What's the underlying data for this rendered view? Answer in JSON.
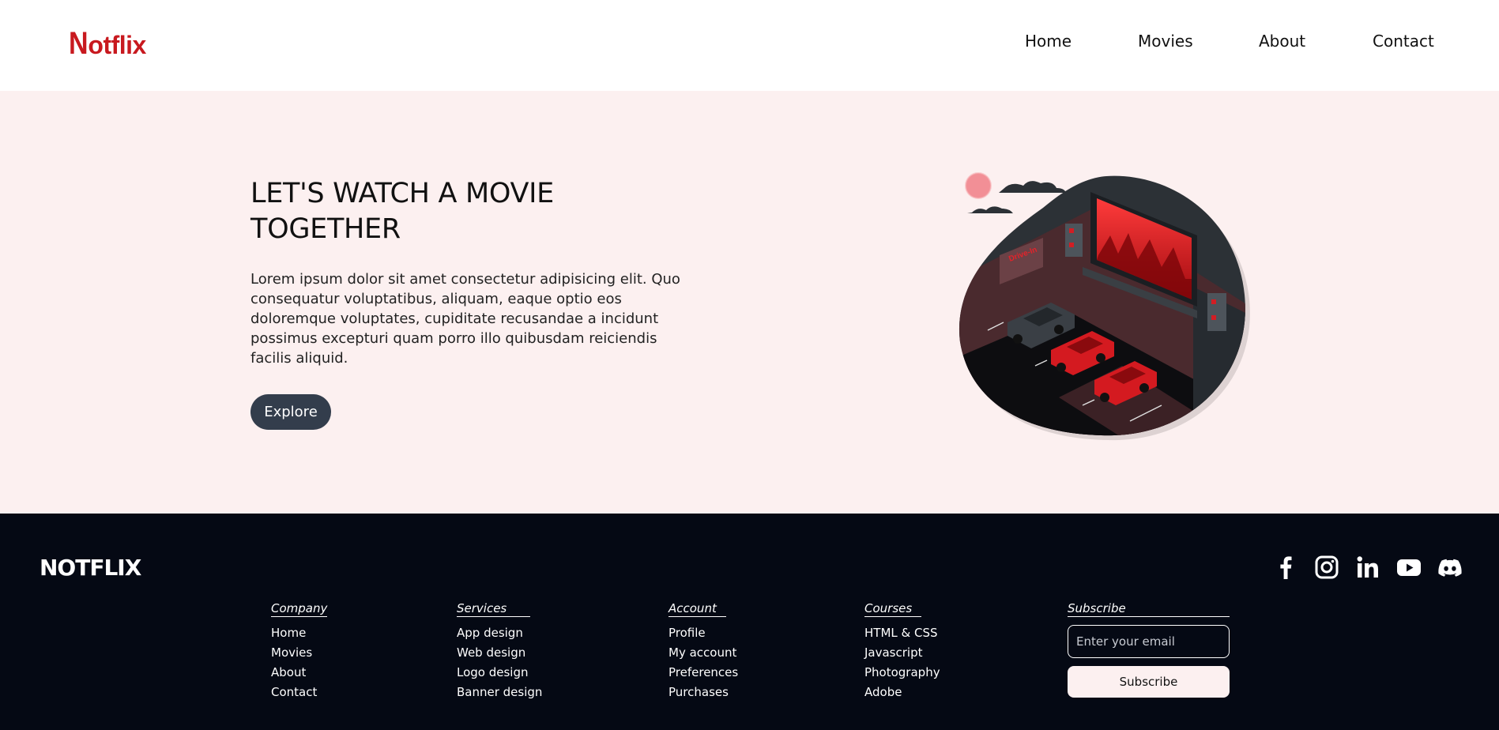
{
  "header": {
    "logo_initial": "N",
    "logo_rest": "otflix",
    "nav": [
      {
        "label": "Home"
      },
      {
        "label": "Movies"
      },
      {
        "label": "About"
      },
      {
        "label": "Contact"
      }
    ]
  },
  "hero": {
    "title": "LET'S WATCH A MOVIE TOGETHER",
    "text": "Lorem ipsum dolor sit amet consectetur adipisicing elit. Quo consequatur voluptatibus, aliquam, eaque optio eos doloremque voluptates, cupiditate recusandae a incidunt possimus excepturi quam porro illo quibusdam reiciendis facilis aliquid.",
    "button": "Explore",
    "illustration_billboard_text": "Drive-In"
  },
  "footer": {
    "brand": "NOTFLIX",
    "socials": [
      "facebook-icon",
      "instagram-icon",
      "linkedin-icon",
      "youtube-icon",
      "discord-icon"
    ],
    "columns": [
      {
        "title": "Company",
        "items": [
          "Home",
          "Movies",
          "About",
          "Contact"
        ]
      },
      {
        "title": "Services",
        "items": [
          "App design",
          "Web design",
          "Logo design",
          "Banner design"
        ]
      },
      {
        "title": "Account",
        "items": [
          "Profile",
          "My account",
          "Preferences",
          "Purchases"
        ]
      },
      {
        "title": "Courses",
        "items": [
          "HTML & CSS",
          "Javascript",
          "Photography",
          "Adobe"
        ]
      }
    ],
    "subscribe": {
      "title": "Subscribe",
      "placeholder": "Enter your email",
      "button": "Subscribe"
    }
  },
  "colors": {
    "brand_red": "#c8191f",
    "hero_bg": "#fcf0f0",
    "button_dark": "#333d4c",
    "footer_bg": "#050914"
  }
}
